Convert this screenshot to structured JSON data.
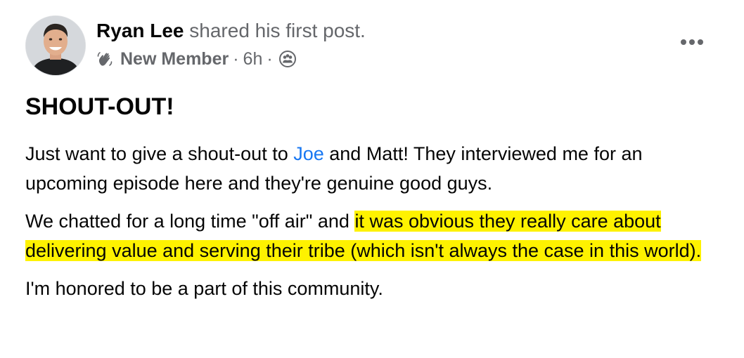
{
  "post": {
    "author_name": "Ryan Lee",
    "action_text": "shared his first post.",
    "badge_label": "New Member",
    "separator": "·",
    "time": "6h",
    "title": "SHOUT-OUT!",
    "paragraph1": {
      "before": "Just want to give a shout-out to ",
      "mention": "Joe",
      "after": " and Matt! They interviewed me for an upcoming episode here and they're genuine good guys."
    },
    "paragraph2": {
      "before": "We chatted for a long time \"off air\" and ",
      "highlighted": "it was obvious they really care about delivering value and serving their tribe (which isn't always the case in this world)."
    },
    "paragraph3": "I'm honored to be a part of this community."
  },
  "icons": {
    "badge": "waving-hand-icon",
    "audience": "group-members-icon",
    "more": "more-options-icon"
  },
  "colors": {
    "text_primary": "#050505",
    "text_secondary": "#65676b",
    "link": "#1877f2",
    "highlight": "#fef200"
  }
}
